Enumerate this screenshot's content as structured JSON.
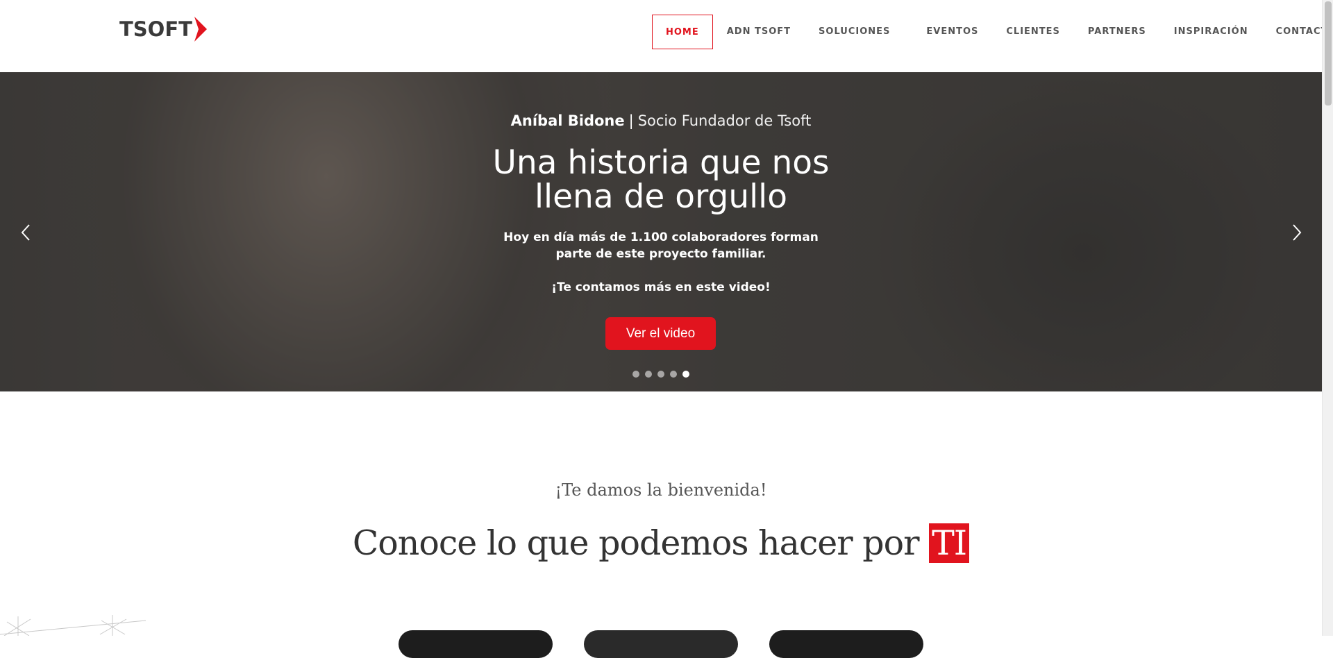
{
  "brand": {
    "logo_text": "TSOFT",
    "accent_color": "#e1141e"
  },
  "nav": {
    "items": [
      {
        "label": "HOME",
        "active": true
      },
      {
        "label": "ADN TSOFT"
      },
      {
        "label": "SOLUCIONES"
      },
      {
        "label": "EVENTOS"
      },
      {
        "label": "CLIENTES"
      },
      {
        "label": "PARTNERS"
      },
      {
        "label": "INSPIRACIÓN"
      },
      {
        "label": "CONTACTO"
      }
    ]
  },
  "hero": {
    "name": "Aníbal Bidone",
    "separator": "|",
    "role": "Socio Fundador de Tsoft",
    "title": "Una historia que nos llena de orgullo",
    "description": "Hoy en día más de 1.100 colaboradores forman parte de este proyecto familiar.",
    "cta_text": "¡Te contamos más en este video!",
    "button_label": "Ver el video",
    "prev_icon": "chevron-left-icon",
    "next_icon": "chevron-right-icon",
    "slide_count": 5,
    "active_slide": 5
  },
  "welcome": {
    "subtitle": "¡Te damos la bienvenida!",
    "title_main": "Conoce lo que podemos hacer por",
    "title_highlight": "TI"
  }
}
